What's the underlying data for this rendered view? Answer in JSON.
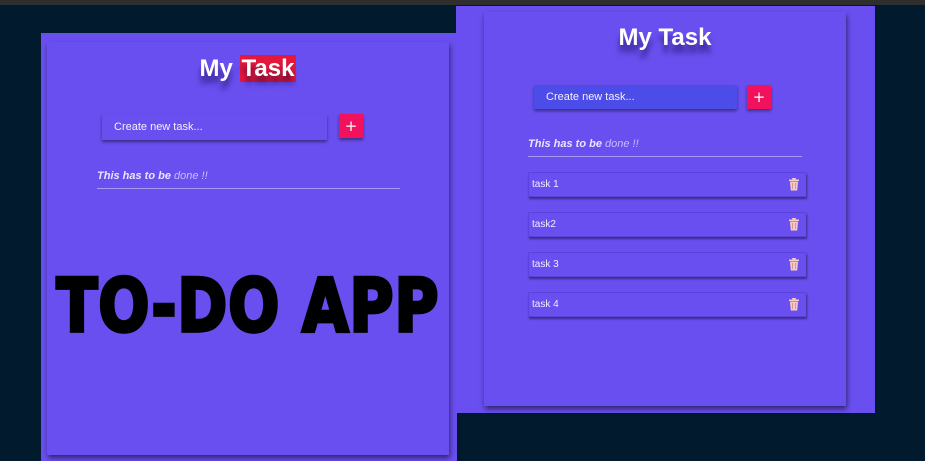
{
  "left_app": {
    "title_plain": "My",
    "title_highlight": "Task",
    "input_placeholder": "Create new task...",
    "add_label": "+",
    "note_bold": "This has to be",
    "note_rest": "done !!",
    "banner": "TO-DO APP"
  },
  "right_app": {
    "title": "My Task",
    "input_placeholder": "Create new task...",
    "add_label": "+",
    "note_bold": "This has to be",
    "note_rest": "done !!",
    "tasks": [
      {
        "label": "task 1",
        "icon": "trash-icon"
      },
      {
        "label": "task2",
        "icon": "trash-icon"
      },
      {
        "label": "task 3",
        "icon": "trash-icon"
      },
      {
        "label": "task 4",
        "icon": "trash-icon"
      }
    ]
  },
  "colors": {
    "background": "#021a2e",
    "card": "#6a4ff0",
    "highlight": "#e3183b",
    "add_button": "#f2115c",
    "input_right": "#4c4ce8"
  }
}
